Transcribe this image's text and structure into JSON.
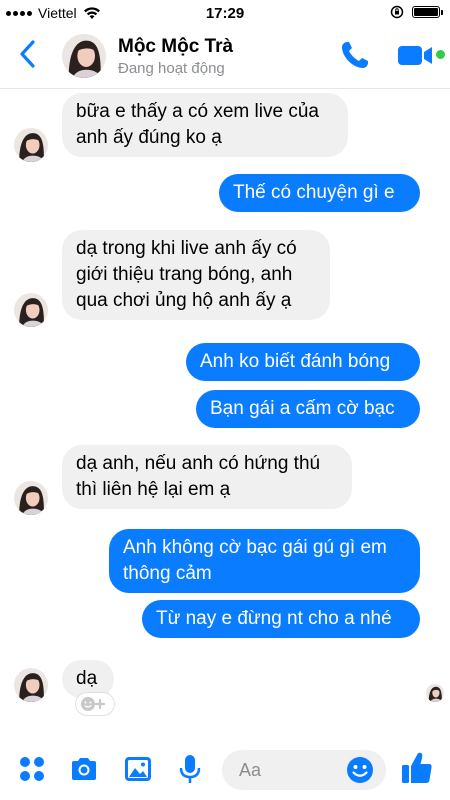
{
  "status_bar": {
    "carrier": "Viettel",
    "time": "17:29"
  },
  "header": {
    "contact_name": "Mộc Mộc Trà",
    "contact_status": "Đang hoạt động"
  },
  "messages": [
    {
      "side": "in",
      "lines": [
        "bữa e thấy a có xem live của",
        "anh ấy đúng ko ạ"
      ]
    },
    {
      "side": "out",
      "lines": [
        "Thế có chuyện gì e"
      ]
    },
    {
      "side": "in",
      "lines": [
        "dạ trong khi live anh ấy có",
        "giới thiệu trang bóng, anh",
        "qua chơi ủng hộ anh ấy ạ"
      ]
    },
    {
      "side": "out",
      "lines": [
        "Anh ko biết đánh bóng"
      ]
    },
    {
      "side": "out",
      "lines": [
        "Bạn gái a cấm cờ bạc"
      ]
    },
    {
      "side": "in",
      "lines": [
        "dạ anh, nếu anh có hứng thú",
        "thì liên hệ lại em ạ"
      ]
    },
    {
      "side": "out",
      "lines": [
        "Anh không cờ bạc gái gú gì em",
        "thông cảm"
      ]
    },
    {
      "side": "out",
      "lines": [
        "Từ nay e đừng nt cho a nhé"
      ]
    },
    {
      "side": "in",
      "lines": [
        "dạ"
      ]
    }
  ],
  "composer": {
    "placeholder": "Aa"
  },
  "colors": {
    "accent": "#0a7cff",
    "incoming_bubble": "#f0f0f0",
    "online": "#31cc46"
  },
  "icons": {
    "back": "chevron-left-icon",
    "call": "phone-icon",
    "video": "video-camera-icon",
    "apps": "four-dots-icon",
    "camera": "camera-icon",
    "gallery": "image-icon",
    "mic": "microphone-icon",
    "emoji": "smiley-icon",
    "like": "thumbs-up-icon",
    "reaction": "add-reaction-icon"
  }
}
